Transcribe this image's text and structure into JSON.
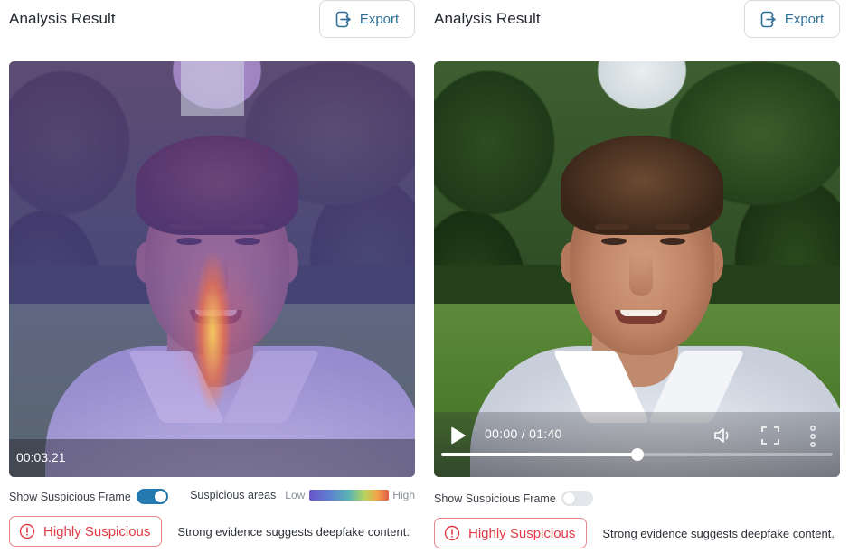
{
  "left_panel": {
    "title": "Analysis Result",
    "export_label": "Export",
    "timestamp": "00:03.21",
    "toggle_label": "Show Suspicious Frame",
    "toggle_state": "on",
    "legend_label": "Suspicious areas",
    "legend_low": "Low",
    "legend_high": "High",
    "verdict": "Highly Suspicious",
    "verdict_description": "Strong evidence suggests deepfake content."
  },
  "right_panel": {
    "title": "Analysis Result",
    "export_label": "Export",
    "video_time": "00:00 / 01:40",
    "progress_fraction": 0.5,
    "toggle_label": "Show Suspicious Frame",
    "toggle_state": "off",
    "verdict": "Highly Suspicious",
    "verdict_description": "Strong evidence suggests deepfake content."
  },
  "icons": {
    "export": "export-icon",
    "play": "play-icon",
    "volume": "volume-icon",
    "fullscreen": "fullscreen-icon",
    "more": "more-vertical-icon",
    "alert": "alert-circle-icon"
  },
  "colors": {
    "accent": "#2479b0",
    "danger": "#e03a45"
  }
}
